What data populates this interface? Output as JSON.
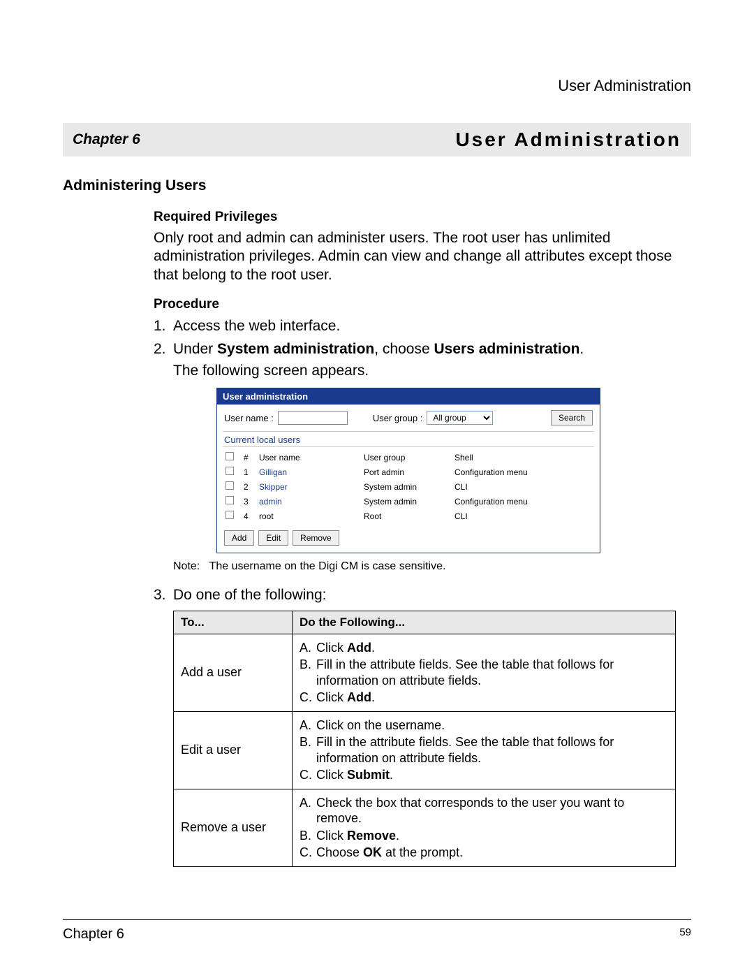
{
  "header": {
    "running": "User Administration"
  },
  "chapter": {
    "label": "Chapter 6",
    "title": "User Administration"
  },
  "section": {
    "heading": "Administering Users"
  },
  "privileges": {
    "subhead": "Required Privileges",
    "text": "Only root and admin can administer users. The root user has unlimited administration privileges. Admin can view and change all attributes except those that belong to the root user."
  },
  "procedure": {
    "subhead": "Procedure",
    "steps": [
      {
        "num": "1.",
        "text": "Access the web interface."
      },
      {
        "num": "2.",
        "prefix": "Under ",
        "bold1": "System administration",
        "mid": ", choose ",
        "bold2": "Users administration",
        "suffix": ".",
        "after": "The following screen appears."
      },
      {
        "num": "3.",
        "text": "Do one of the following:"
      }
    ]
  },
  "screenshot": {
    "title": "User administration",
    "usernameLabel": "User name :",
    "usergroupLabel": "User group :",
    "groupSelected": "All group",
    "searchBtn": "Search",
    "sectionHead": "Current local users",
    "cols": {
      "hash": "#",
      "name": "User name",
      "group": "User group",
      "shell": "Shell"
    },
    "rows": [
      {
        "n": "1",
        "name": "Gilligan",
        "group": "Port admin",
        "shell": "Configuration menu",
        "link": true
      },
      {
        "n": "2",
        "name": "Skipper",
        "group": "System admin",
        "shell": "CLI",
        "link": true
      },
      {
        "n": "3",
        "name": "admin",
        "group": "System admin",
        "shell": "Configuration menu",
        "link": true
      },
      {
        "n": "4",
        "name": "root",
        "group": "Root",
        "shell": "CLI",
        "link": false
      }
    ],
    "buttons": {
      "add": "Add",
      "edit": "Edit",
      "remove": "Remove"
    }
  },
  "note": {
    "label": "Note:",
    "text": "The username on the Digi CM is case sensitive."
  },
  "actionTable": {
    "head": {
      "to": "To...",
      "do": "Do the Following..."
    },
    "rows": [
      {
        "to": "Add a user",
        "items": [
          {
            "l": "A.",
            "pre": "Click ",
            "b": "Add",
            "post": "."
          },
          {
            "l": "B.",
            "pre": "Fill in the attribute fields. See the table that follows for information on attribute fields.",
            "b": "",
            "post": ""
          },
          {
            "l": "C.",
            "pre": "Click ",
            "b": "Add",
            "post": "."
          }
        ]
      },
      {
        "to": "Edit a user",
        "items": [
          {
            "l": "A.",
            "pre": "Click on the username.",
            "b": "",
            "post": ""
          },
          {
            "l": "B.",
            "pre": "Fill in the attribute fields. See the table that follows for information on attribute fields.",
            "b": "",
            "post": ""
          },
          {
            "l": "C.",
            "pre": "Click ",
            "b": "Submit",
            "post": "."
          }
        ]
      },
      {
        "to": "Remove a user",
        "items": [
          {
            "l": "A.",
            "pre": "Check the box that corresponds to the user you want to remove.",
            "b": "",
            "post": ""
          },
          {
            "l": "B.",
            "pre": "Click ",
            "b": "Remove",
            "post": "."
          },
          {
            "l": "C.",
            "pre": "Choose ",
            "b": "OK",
            "post": " at the prompt."
          }
        ]
      }
    ]
  },
  "footer": {
    "left": "Chapter 6",
    "right": "59"
  }
}
